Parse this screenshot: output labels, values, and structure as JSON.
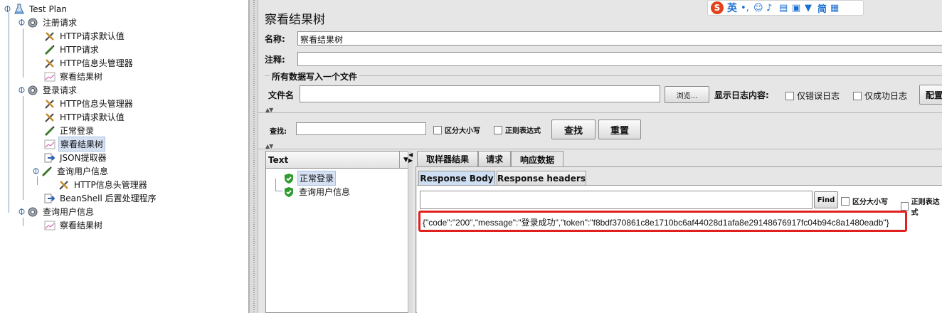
{
  "tree": {
    "nodes": [
      {
        "label": "Test Plan",
        "icon": "flask-icon"
      },
      {
        "label": "注册请求",
        "icon": "gear-icon"
      },
      {
        "label": "HTTP请求默认值",
        "icon": "tools-icon"
      },
      {
        "label": "HTTP请求",
        "icon": "pen-icon"
      },
      {
        "label": "HTTP信息头管理器",
        "icon": "tools-icon"
      },
      {
        "label": "察看结果树",
        "icon": "chart-icon"
      },
      {
        "label": "登录请求",
        "icon": "gear-icon"
      },
      {
        "label": "HTTP信息头管理器",
        "icon": "tools-icon"
      },
      {
        "label": "HTTP请求默认值",
        "icon": "tools-icon"
      },
      {
        "label": "正常登录",
        "icon": "pen-icon"
      },
      {
        "label": "察看结果树",
        "icon": "chart-icon"
      },
      {
        "label": "JSON提取器",
        "icon": "arrow-icon"
      },
      {
        "label": "查询用户信息",
        "icon": "pen-icon"
      },
      {
        "label": "HTTP信息头管理器",
        "icon": "tools-icon"
      },
      {
        "label": "BeanShell 后置处理程序",
        "icon": "arrow-icon"
      },
      {
        "label": "查询用户信息",
        "icon": "gear-icon"
      },
      {
        "label": "察看结果树",
        "icon": "chart-icon"
      }
    ]
  },
  "ime": {
    "label": "英"
  },
  "panel": {
    "title": "察看结果树",
    "name_label": "名称:",
    "name_value": "察看结果树",
    "comment_label": "注释:",
    "comment_value": "",
    "file_group_title": "所有数据写入一个文件",
    "filename_label": "文件名",
    "filename_value": "",
    "browse_button": "浏览...",
    "log_label": "显示日志内容:",
    "errors_only": "仅错误日志",
    "success_only": "仅成功日志",
    "configure_button": "配置"
  },
  "search": {
    "label": "查找:",
    "value": "",
    "case_sensitive": "区分大小写",
    "regex": "正则表达式",
    "find_button": "查找",
    "reset_button": "重置"
  },
  "results": {
    "renderer": "Text",
    "items": [
      "正常登录",
      "查询用户信息"
    ]
  },
  "tabs": [
    "取样器结果",
    "请求",
    "响应数据"
  ],
  "subtabs": [
    "Response Body",
    "Response headers"
  ],
  "response": {
    "find_button": "Find",
    "case_sensitive": "区分大小写",
    "regex": "正则表达式",
    "body": "{\"code\":\"200\",\"message\":\"登录成功\",\"token\":\"f8bdf370861c8e1710bc6af44028d1afa8e29148676917fc04b94c8a1480eadb\"}"
  },
  "colors": {
    "highlight_box": "#e0201c",
    "selection": "#d6e2f4",
    "success_shield": "#2e9b2e"
  }
}
